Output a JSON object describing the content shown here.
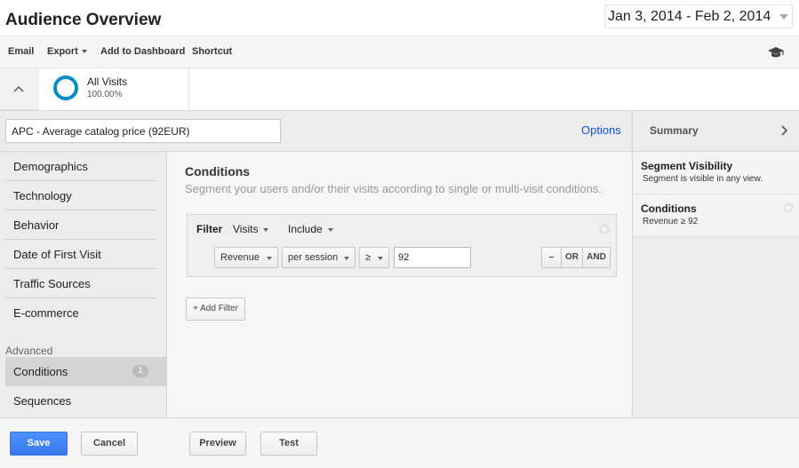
{
  "header": {
    "title": "Audience Overview",
    "date_range": "Jan 3, 2014 - Feb 2, 2014"
  },
  "toolbar": {
    "email": "Email",
    "export": "Export",
    "add_to_dashboard": "Add to Dashboard",
    "shortcut": "Shortcut",
    "academy_icon": "graduation-cap-icon"
  },
  "segment": {
    "name": "All Visits",
    "percent": "100.00%",
    "ring_color": "#058dc7"
  },
  "editor": {
    "segment_name": "APC - Average catalog price (92EUR)",
    "options": "Options",
    "nav": {
      "items": [
        "Demographics",
        "Technology",
        "Behavior",
        "Date of First Visit",
        "Traffic Sources",
        "E-commerce"
      ],
      "advanced_label": "Advanced",
      "conditions": "Conditions",
      "conditions_count": "1",
      "sequences": "Sequences"
    },
    "conditions": {
      "title": "Conditions",
      "description": "Segment your users and/or their visits according to single or multi-visit conditions.",
      "filter": {
        "label": "Filter",
        "scope": "Visits",
        "mode": "Include",
        "metric": "Revenue",
        "per": "per session",
        "operator": "≥",
        "value": "92",
        "remove": "–",
        "or": "OR",
        "and": "AND"
      },
      "add_filter": "+ Add Filter"
    },
    "summary": {
      "title": "Summary",
      "visibility_title": "Segment Visibility",
      "visibility_text": "Segment is visible in any view.",
      "conditions_title": "Conditions",
      "conditions_text": "Revenue ≥ 92"
    }
  },
  "footer": {
    "save": "Save",
    "cancel": "Cancel",
    "preview": "Preview",
    "test": "Test"
  },
  "colors": {
    "primary_button": "#4d90fe",
    "link": "#15c"
  }
}
